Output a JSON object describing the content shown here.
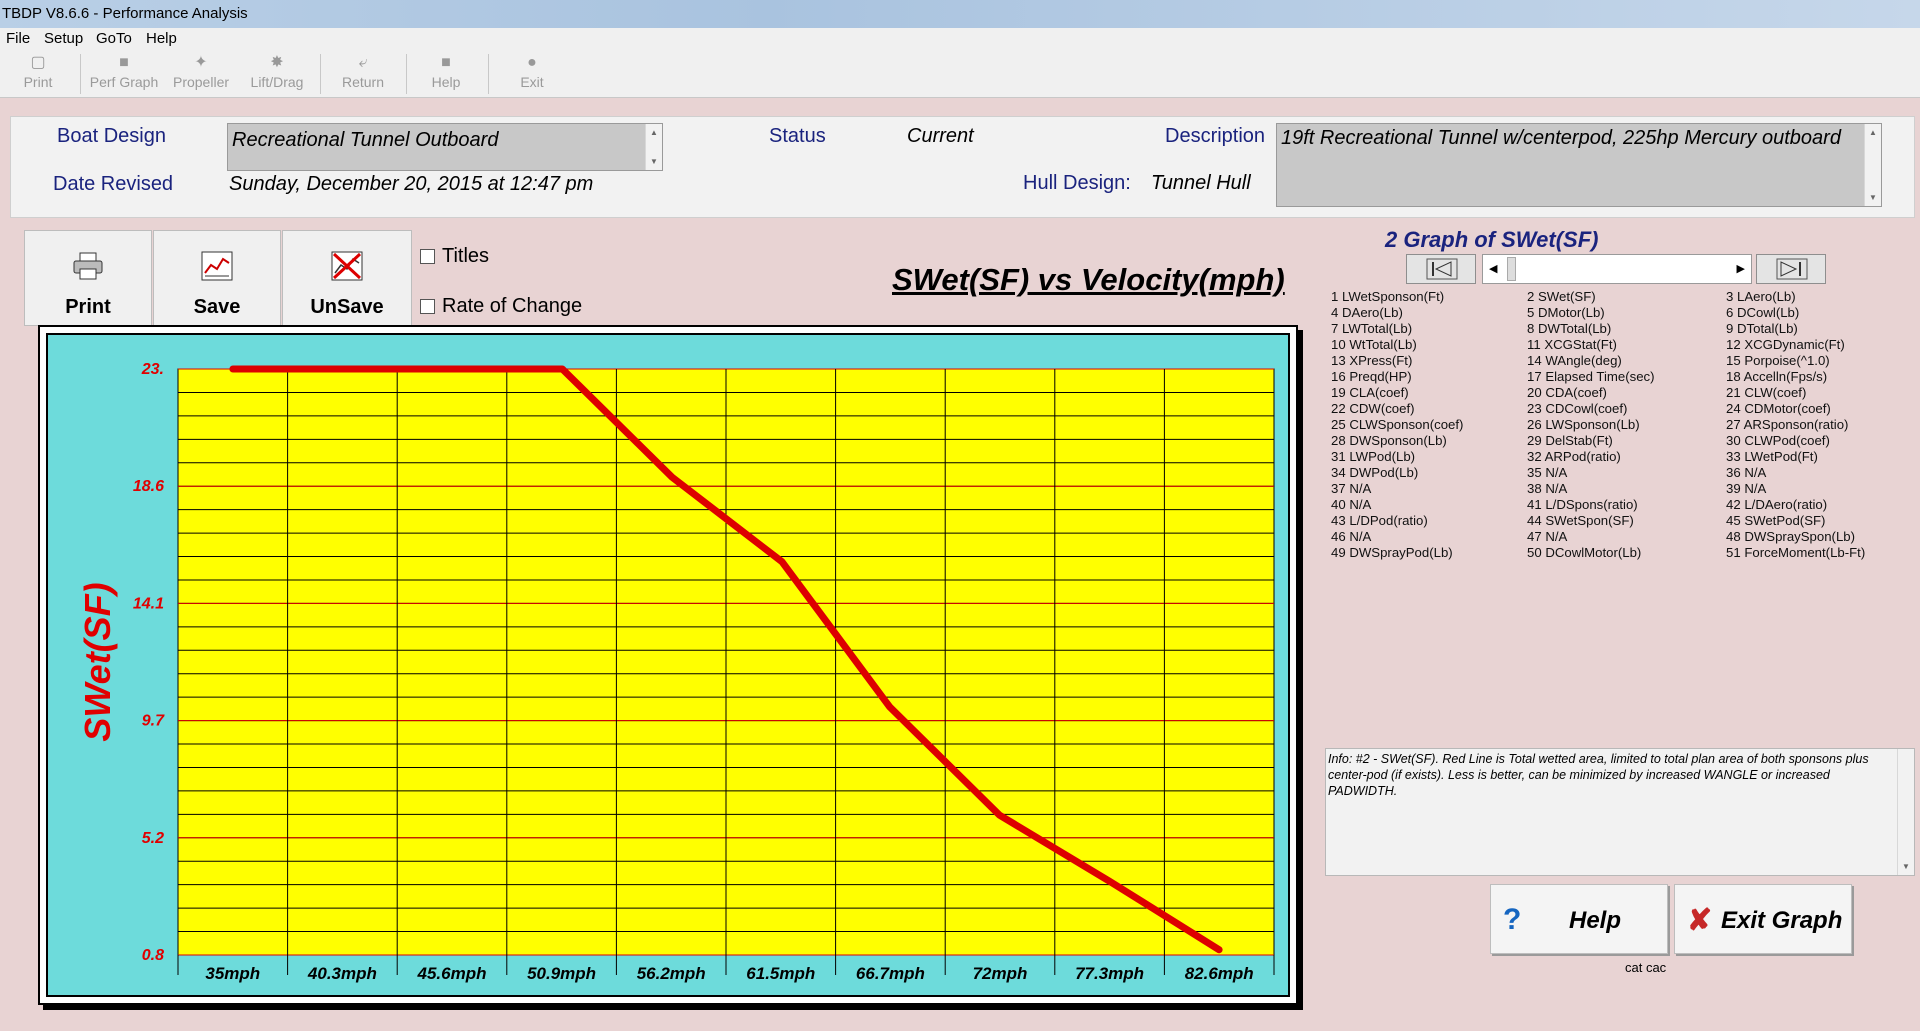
{
  "window": {
    "title": "TBDP V8.6.6 - Performance Analysis"
  },
  "menu": [
    "File",
    "Setup",
    "GoTo",
    "Help"
  ],
  "toolbar": [
    "Print",
    "Perf Graph",
    "Propeller",
    "Lift/Drag",
    "Return",
    "Help",
    "Exit"
  ],
  "header": {
    "boat_design_label": "Boat Design",
    "boat_design_value": "Recreational Tunnel Outboard",
    "date_revised_label": "Date Revised",
    "date_revised_value": "Sunday, December 20, 2015 at 12:47 pm",
    "status_label": "Status",
    "status_value": "Current",
    "hull_design_label": "Hull Design:",
    "hull_design_value": "Tunnel Hull",
    "description_label": "Description",
    "description_value": "19ft Recreational Tunnel w/centerpod, 225hp Mercury outboard"
  },
  "graph_buttons": {
    "print": "Print",
    "save": "Save",
    "unsave": "UnSave"
  },
  "options": {
    "titles": "Titles",
    "rate_of_change": "Rate of Change"
  },
  "graph_header": "2 Graph of SWet(SF)",
  "parameters": [
    "1 LWetSponson(Ft)",
    "2 SWet(SF)",
    "3 LAero(Lb)",
    "4 DAero(Lb)",
    "5 DMotor(Lb)",
    "6 DCowl(Lb)",
    "7 LWTotal(Lb)",
    "8 DWTotal(Lb)",
    "9 DTotal(Lb)",
    "10 WtTotal(Lb)",
    "11 XCGStat(Ft)",
    "12 XCGDynamic(Ft)",
    "13 XPress(Ft)",
    "14 WAngle(deg)",
    "15 Porpoise(^1.0)",
    "16 Preqd(HP)",
    "17 Elapsed Time(sec)",
    "18 Accelln(Fps/s)",
    "19 CLA(coef)",
    "20 CDA(coef)",
    "21 CLW(coef)",
    "22 CDW(coef)",
    "23 CDCowl(coef)",
    "24 CDMotor(coef)",
    "25 CLWSponson(coef)",
    "26 LWSponson(Lb)",
    "27 ARSponson(ratio)",
    "28 DWSponson(Lb)",
    "29 DelStab(Ft)",
    "30 CLWPod(coef)",
    "31 LWPod(Lb)",
    "32 ARPod(ratio)",
    "33 LWetPod(Ft)",
    "34 DWPod(Lb)",
    "35 N/A",
    "36 N/A",
    "37 N/A",
    "38 N/A",
    "39 N/A",
    "40 N/A",
    "41 L/DSpons(ratio)",
    "42 L/DAero(ratio)",
    "43 L/DPod(ratio)",
    "44 SWetSpon(SF)",
    "45 SWetPod(SF)",
    "46 N/A",
    "47 N/A",
    "48 DWSpraySpon(Lb)",
    "49 DWSprayPod(Lb)",
    "50 DCowlMotor(Lb)",
    "51 ForceMoment(Lb-Ft)"
  ],
  "info": "Info: #2 - SWet(SF). Red Line is Total wetted area, limited to total plan area of both sponsons plus center-pod (if exists).  Less is better, can be minimized by increased WANGLE or increased PADWIDTH.",
  "actions": {
    "help": "Help",
    "exit": "Exit Graph"
  },
  "footer_note": "cat cac",
  "chart_data": {
    "type": "line",
    "title": "SWet(SF) vs Velocity(mph)",
    "ylabel": "SWet(SF)",
    "xlabel": "",
    "x_tick_labels": [
      "35mph",
      "40.3mph",
      "45.6mph",
      "50.9mph",
      "56.2mph",
      "61.5mph",
      "66.7mph",
      "72mph",
      "77.3mph",
      "82.6mph"
    ],
    "y_tick_labels": [
      "23.",
      "18.6",
      "14.1",
      "9.7",
      "5.2",
      "0.8"
    ],
    "xlim": [
      32.35,
      85.25
    ],
    "ylim": [
      0.8,
      23.0
    ],
    "grid": true,
    "series": [
      {
        "color": "#dd0000",
        "x": [
          35,
          50.9,
          56.2,
          61.5,
          66.7,
          72,
          77.3,
          82.6
        ],
        "y": [
          23.0,
          23.0,
          18.9,
          15.7,
          10.2,
          6.1,
          3.6,
          1.0
        ]
      }
    ]
  }
}
